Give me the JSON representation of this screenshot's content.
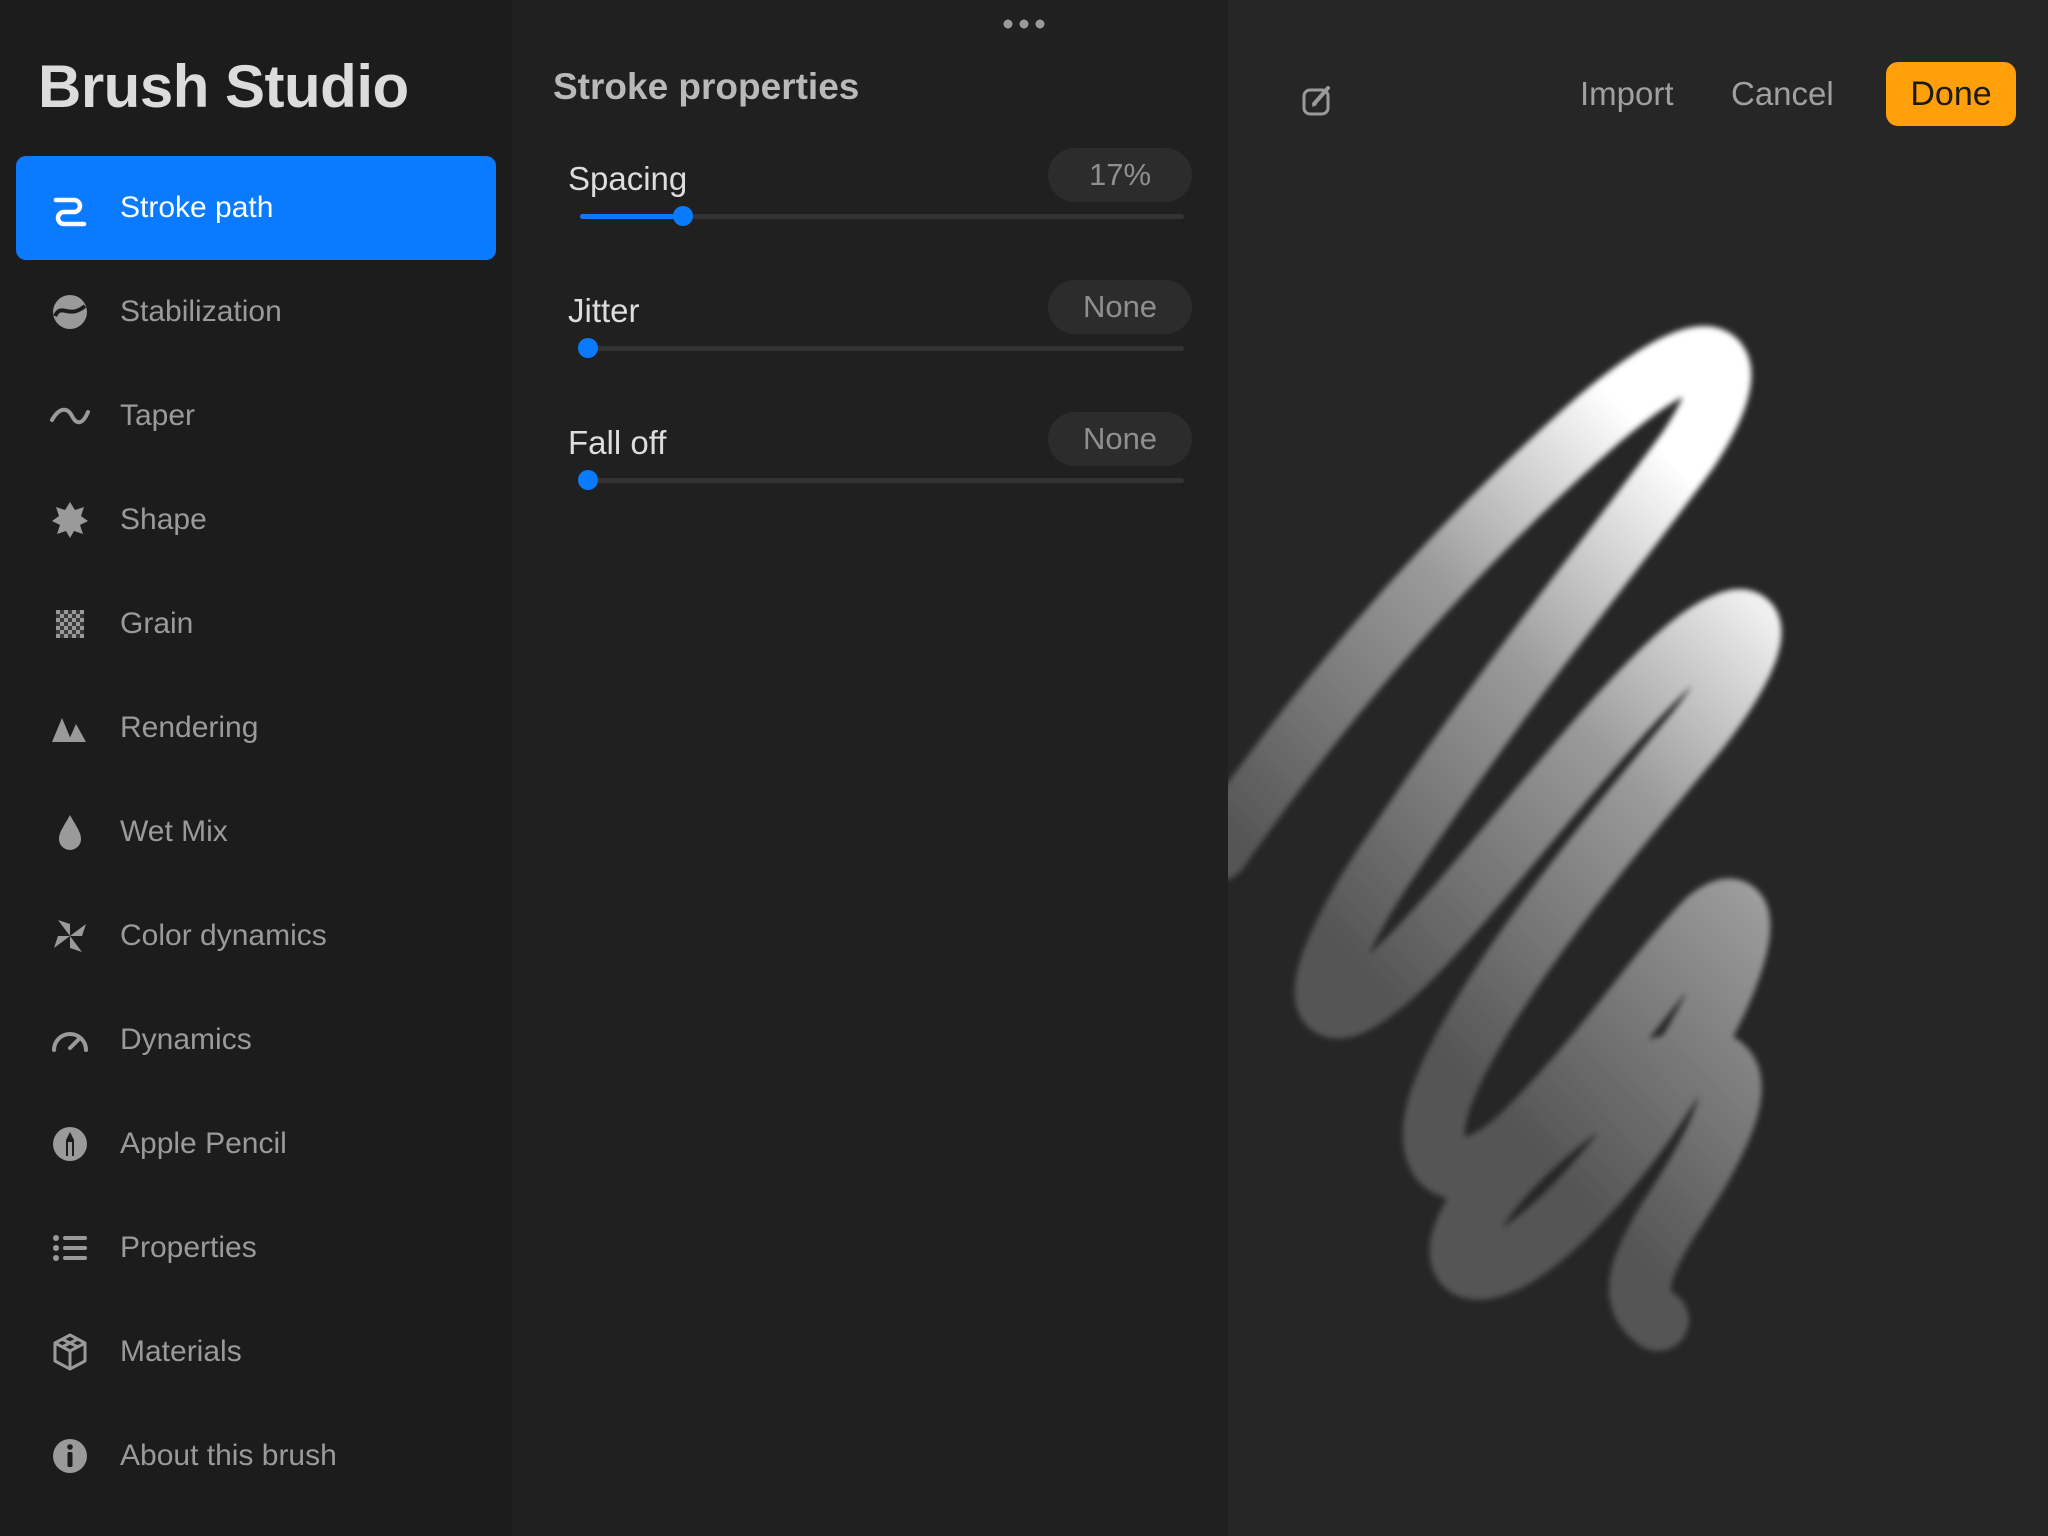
{
  "app": {
    "title": "Brush Studio"
  },
  "sidebar": {
    "items": [
      {
        "label": "Stroke path",
        "icon": "stroke-path-icon",
        "active": true
      },
      {
        "label": "Stabilization",
        "icon": "stabilization-icon"
      },
      {
        "label": "Taper",
        "icon": "taper-icon"
      },
      {
        "label": "Shape",
        "icon": "shape-icon"
      },
      {
        "label": "Grain",
        "icon": "grain-icon"
      },
      {
        "label": "Rendering",
        "icon": "rendering-icon"
      },
      {
        "label": "Wet Mix",
        "icon": "wet-mix-icon"
      },
      {
        "label": "Color dynamics",
        "icon": "color-dynamics-icon"
      },
      {
        "label": "Dynamics",
        "icon": "dynamics-icon"
      },
      {
        "label": "Apple Pencil",
        "icon": "apple-pencil-icon"
      },
      {
        "label": "Properties",
        "icon": "properties-icon"
      },
      {
        "label": "Materials",
        "icon": "materials-icon"
      },
      {
        "label": "About this brush",
        "icon": "info-icon"
      }
    ]
  },
  "panel": {
    "title": "Stroke properties",
    "settings": [
      {
        "label": "Spacing",
        "value": "17%",
        "level": 0.17
      },
      {
        "label": "Jitter",
        "value": "None",
        "level": 0
      },
      {
        "label": "Fall off",
        "value": "None",
        "level": 0
      }
    ]
  },
  "toolbar": {
    "import_label": "Import",
    "cancel_label": "Cancel",
    "done_label": "Done"
  },
  "colors": {
    "accent": "#0a7bff",
    "done": "#ff9f0a",
    "sidebar_bg": "#1c1c1c",
    "panel_bg": "#202020",
    "preview_bg": "#262626"
  }
}
